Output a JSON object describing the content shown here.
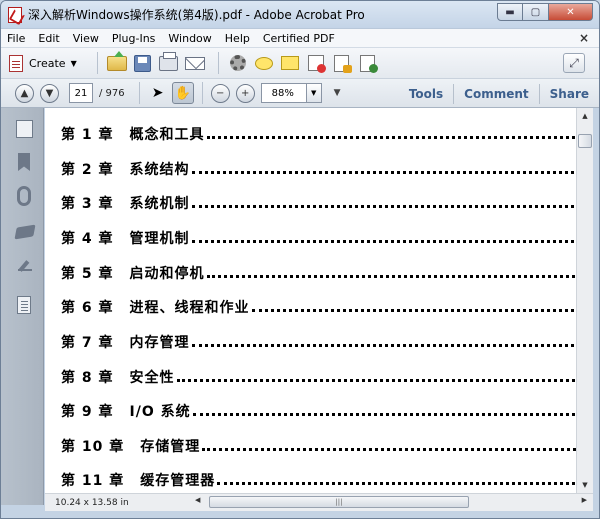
{
  "window": {
    "title": "深入解析Windows操作系统(第4版).pdf - Adobe Acrobat Pro",
    "min_label": "▬",
    "max_label": "▢",
    "close_label": "✕"
  },
  "menu": {
    "items": [
      "File",
      "Edit",
      "View",
      "Plug-Ins",
      "Window",
      "Help",
      "Certified PDF"
    ],
    "close_doc": "×"
  },
  "toolbar1": {
    "create_label": "Create",
    "create_arrow": "▼",
    "expand_symbol": "⤢"
  },
  "toolbar2": {
    "prev_symbol": "▲",
    "next_symbol": "▼",
    "page_current": "21",
    "page_total": "/ 976",
    "select_symbol": "➤",
    "hand_symbol": "✋",
    "zoom_out_symbol": "−",
    "zoom_in_symbol": "+",
    "zoom_value": "88%",
    "zoom_dropdown": "▼",
    "more_symbol": "▼",
    "tools_label": "Tools",
    "comment_label": "Comment",
    "share_label": "Share"
  },
  "toc": [
    {
      "num": "第 1 章",
      "title": "概念和工具"
    },
    {
      "num": "第 2 章",
      "title": "系统结构"
    },
    {
      "num": "第 3 章",
      "title": "系统机制"
    },
    {
      "num": "第 4 章",
      "title": "管理机制"
    },
    {
      "num": "第 5 章",
      "title": "启动和停机"
    },
    {
      "num": "第 6 章",
      "title": "进程、线程和作业"
    },
    {
      "num": "第 7 章",
      "title": "内存管理"
    },
    {
      "num": "第 8 章",
      "title": "安全性"
    },
    {
      "num": "第 9 章",
      "title": "I/O 系统"
    },
    {
      "num": "第 10 章",
      "title": "存储管理"
    },
    {
      "num": "第 11 章",
      "title": "缓存管理器"
    }
  ],
  "status": {
    "page_size": "10.24 x 13.58 in",
    "hthumb_grip": "|||"
  },
  "scroll": {
    "up": "▲",
    "down": "▼",
    "left": "◀",
    "right": "▶"
  }
}
